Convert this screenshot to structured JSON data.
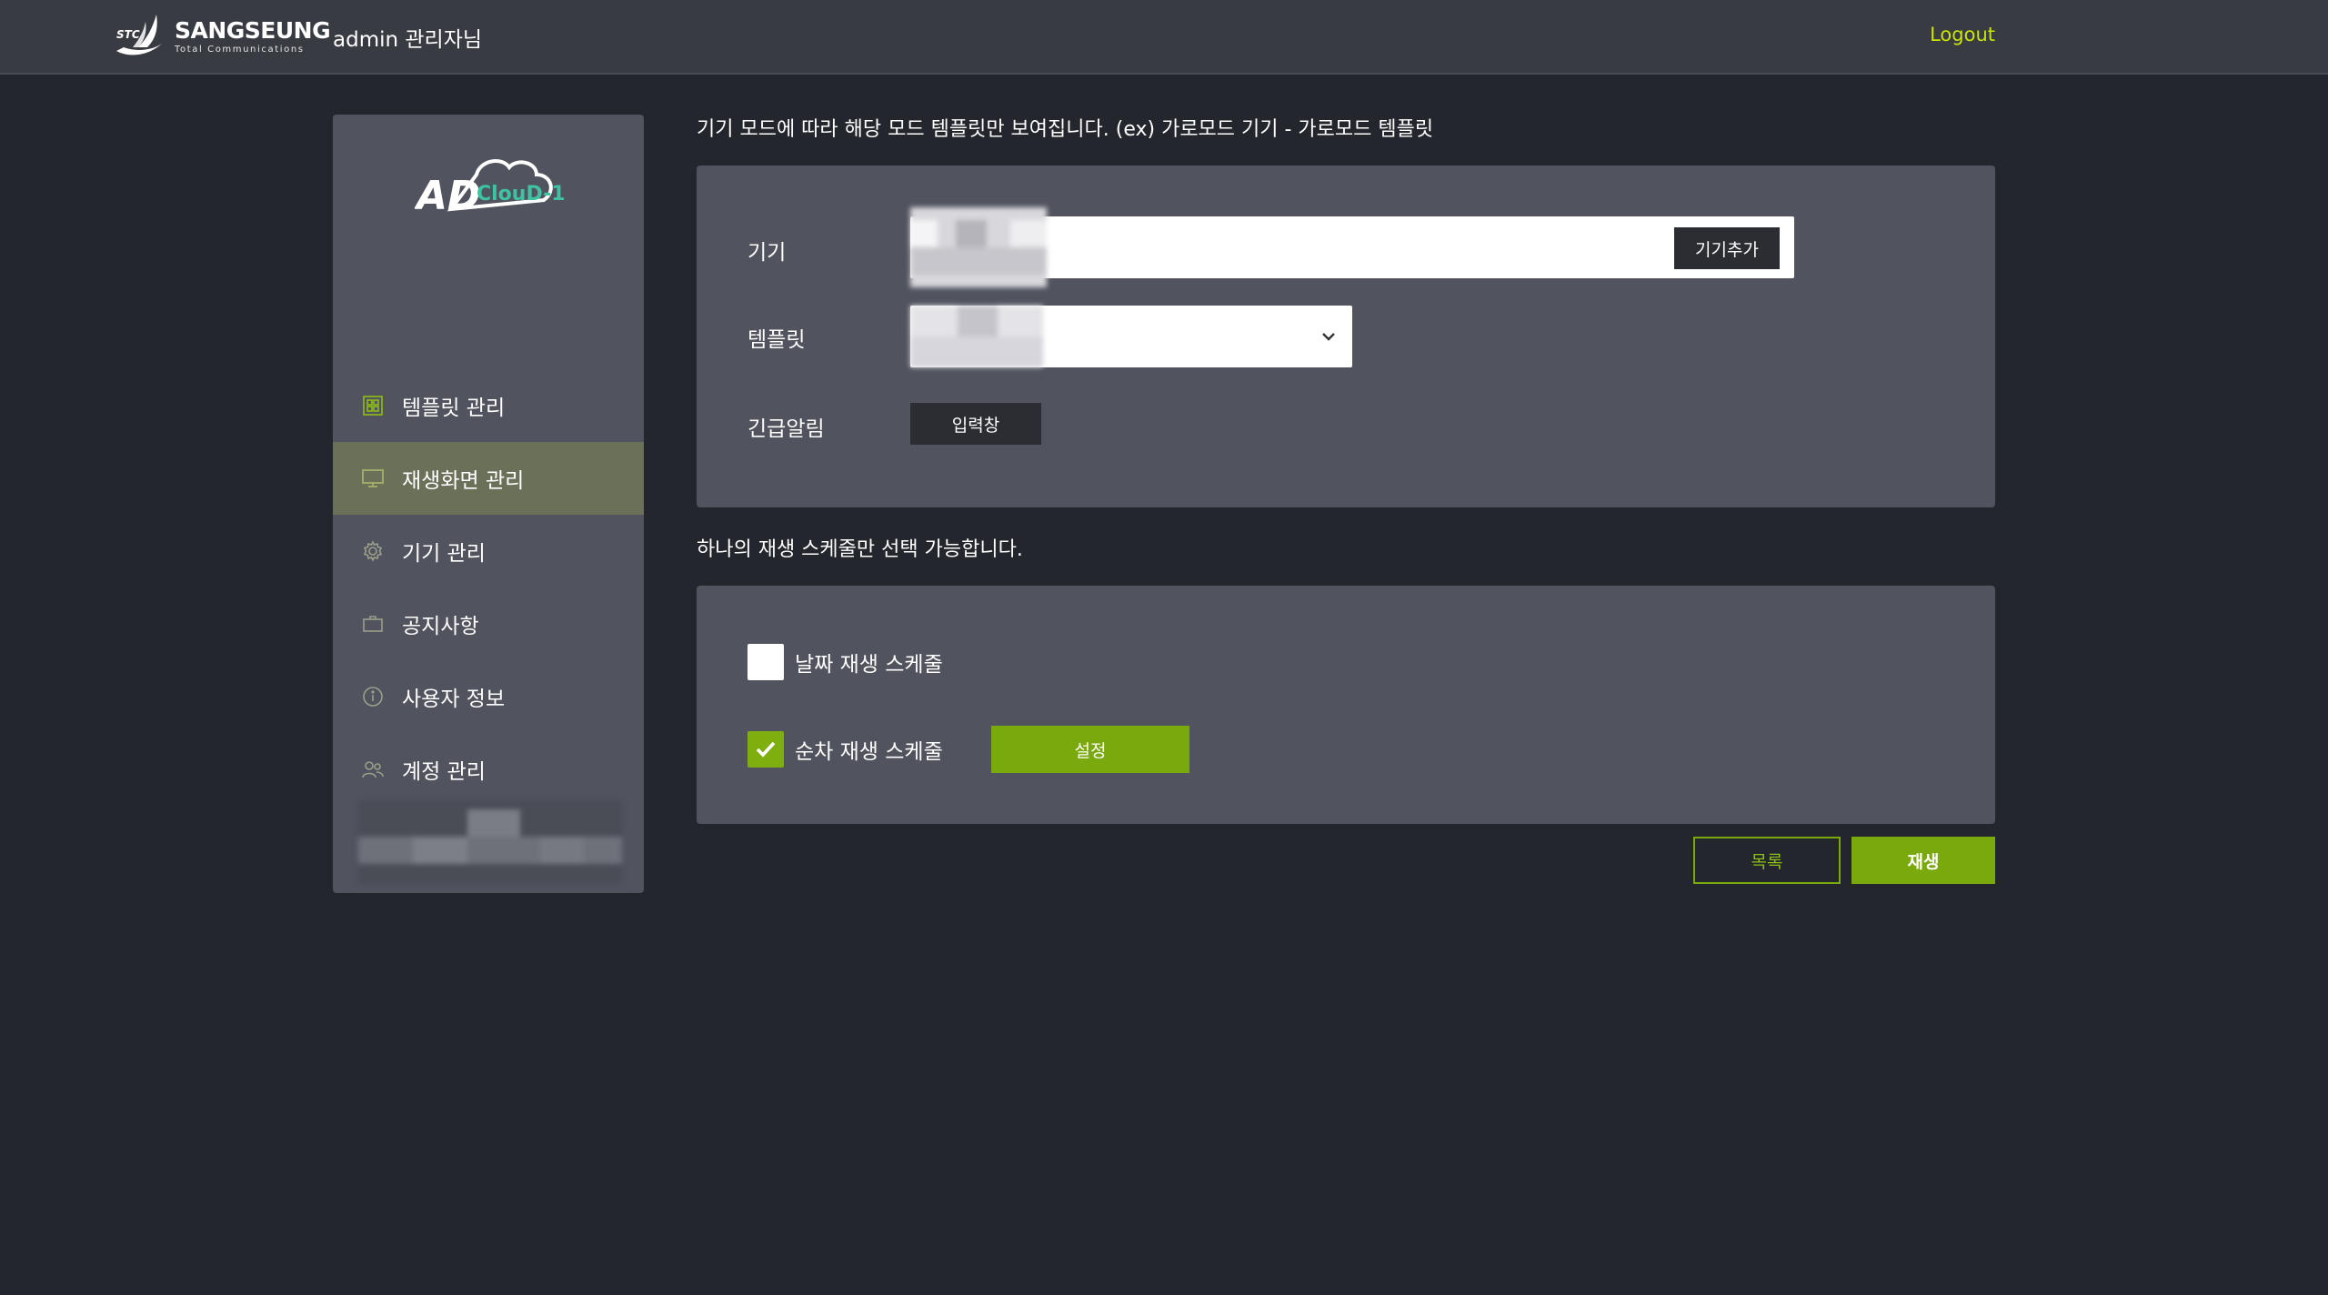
{
  "header": {
    "brand_name": "SANGSEUNG",
    "brand_sub": "Total Communications",
    "brand_mark_text": "STC",
    "admin_label": "admin 관리자님",
    "logout_label": "Logout"
  },
  "sidebar": {
    "logo_text": "ClouD-1",
    "items": [
      {
        "label": "템플릿 관리",
        "icon": "template-icon",
        "active": false
      },
      {
        "label": "재생화면 관리",
        "icon": "monitor-icon",
        "active": true
      },
      {
        "label": "기기 관리",
        "icon": "gear-icon",
        "active": false
      },
      {
        "label": "공지사항",
        "icon": "briefcase-icon",
        "active": false
      },
      {
        "label": "사용자 정보",
        "icon": "info-icon",
        "active": false
      },
      {
        "label": "계정 관리",
        "icon": "users-icon",
        "active": false
      }
    ]
  },
  "main": {
    "notice_template": "기기 모드에 따라 해당 모드 템플릿만 보여집니다. (ex) 가로모드 기기 - 가로모드 템플릿",
    "device_label": "기기",
    "add_device_label": "기기추가",
    "template_label": "템플릿",
    "emergency_label": "긴급알림",
    "emergency_button_label": "입력창",
    "notice_schedule": "하나의 재생 스케줄만 선택 가능합니다.",
    "schedule_date_label": "날짜 재생 스케줄",
    "schedule_date_checked": false,
    "schedule_sequence_label": "순차 재생 스케줄",
    "schedule_sequence_checked": true,
    "setting_button_label": "설정",
    "list_button_label": "목록",
    "play_button_label": "재생"
  },
  "colors": {
    "background": "#24262e",
    "header": "#393b43",
    "panel": "#51535e",
    "accent_green": "#79a90c",
    "logout_yellow": "#c9e400",
    "active_menu": "#6b7058"
  }
}
